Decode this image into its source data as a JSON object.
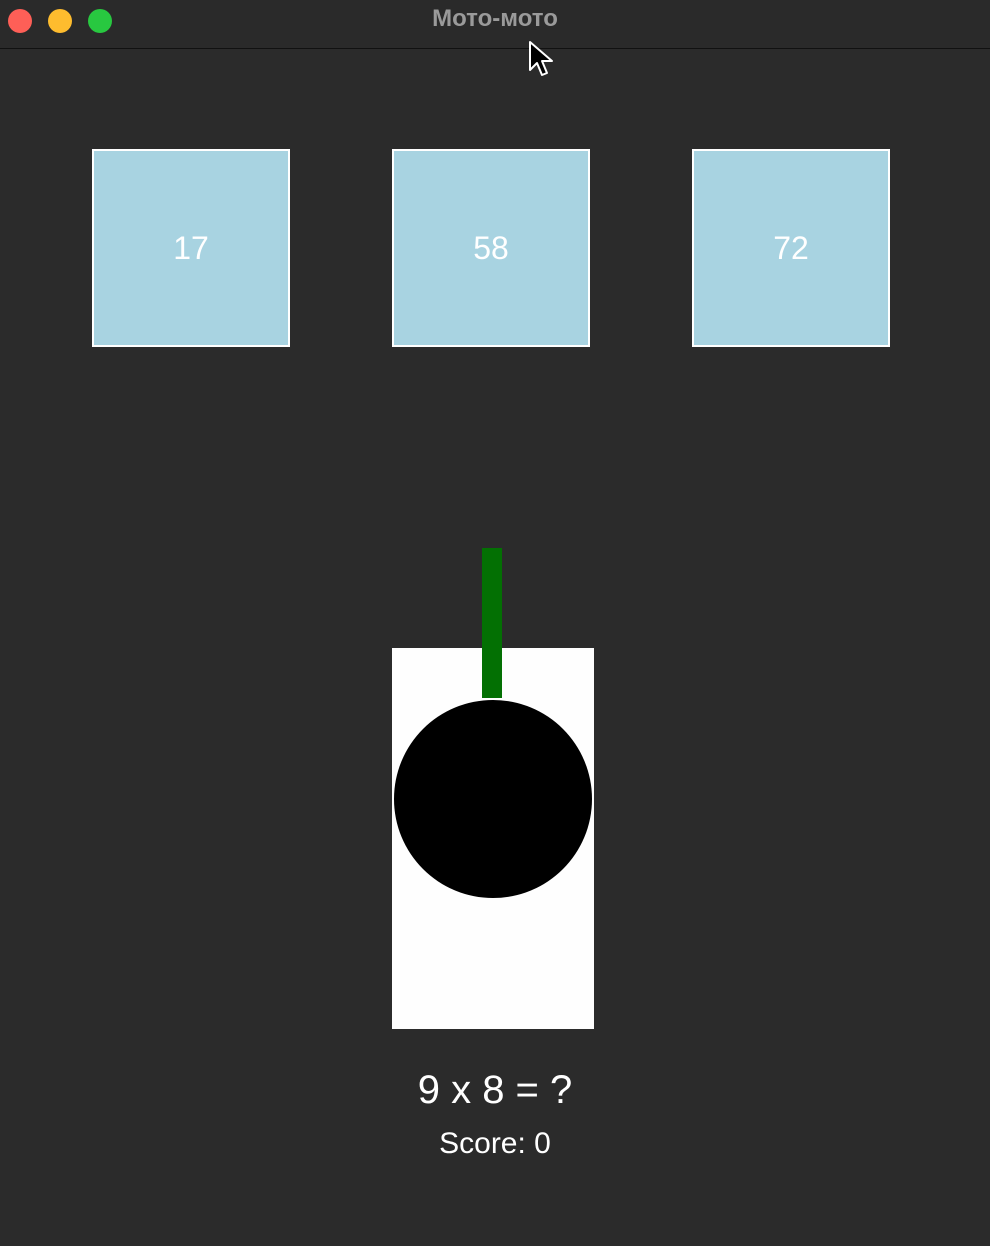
{
  "window": {
    "title": "Мото-мото"
  },
  "targets": [
    {
      "value": "17"
    },
    {
      "value": "58"
    },
    {
      "value": "72"
    }
  ],
  "question": "9 x 8 = ?",
  "score_text": "Score: 0",
  "colors": {
    "background": "#2b2b2b",
    "target_fill": "#a8d3e1",
    "barrel": "#037003",
    "player_body": "#fefefe",
    "turret": "#000000"
  }
}
